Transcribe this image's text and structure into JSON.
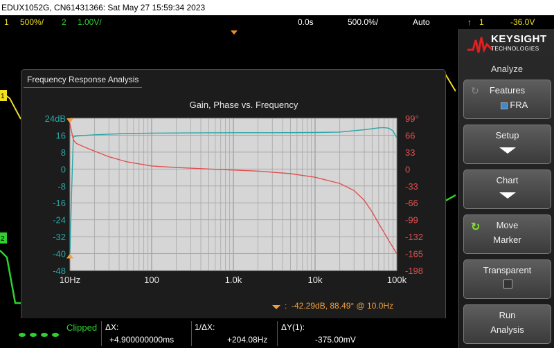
{
  "titlebar": {
    "text": "EDUX1052G, CN61431366: Sat May 27 15:59:34 2023"
  },
  "status": {
    "ch1_num": "1",
    "ch1_scale": "500%/",
    "ch2_num": "2",
    "ch2_scale": "1.00V/",
    "delay": "0.0s",
    "timebase": "500.0%/",
    "trigger_mode": "Auto",
    "trig_source": "1",
    "trig_level": "-36.0V"
  },
  "fra": {
    "window_title": "Frequency Response Analysis",
    "marker_readout": "-42.29dB, 88.49° @ 10.0Hz"
  },
  "chart_data": {
    "type": "line",
    "title": "Gain, Phase vs. Frequency",
    "xscale": "log",
    "x_range": [
      10,
      100000
    ],
    "x_tick_labels": [
      "10Hz",
      "100",
      "1.0k",
      "10k",
      "100k"
    ],
    "y_left_ticks": [
      "24dB",
      "16",
      "8",
      "0",
      "-8",
      "-16",
      "-24",
      "-32",
      "-40",
      "-48"
    ],
    "y_left_range": [
      -48,
      24
    ],
    "y_right_ticks": [
      "99°",
      "66",
      "33",
      "0",
      "-33",
      "-66",
      "-99",
      "-132",
      "-165",
      "-198"
    ],
    "y_right_range": [
      -198,
      99
    ],
    "grid": true,
    "series": [
      {
        "axis": "left",
        "color": "#2aa6a6",
        "x": [
          10,
          10.5,
          11,
          12,
          15,
          20,
          30,
          50,
          100,
          300,
          1000,
          3000,
          10000,
          20000,
          40000,
          60000,
          70000,
          80000,
          90000,
          100000
        ],
        "y": [
          -40,
          -10,
          15.2,
          15.6,
          15.9,
          16.2,
          16.5,
          16.8,
          17.0,
          17.1,
          17.2,
          17.2,
          17.3,
          17.5,
          18.6,
          19.5,
          19.6,
          19.3,
          18.0,
          14.8
        ]
      },
      {
        "axis": "right",
        "color": "#e05050",
        "x": [
          10,
          11,
          12,
          15,
          20,
          30,
          50,
          100,
          200,
          500,
          1000,
          2000,
          5000,
          10000,
          20000,
          30000,
          40000,
          50000,
          60000,
          70000,
          80000,
          90000,
          100000
        ],
        "y": [
          88.5,
          57,
          50,
          43,
          35,
          24,
          14,
          6,
          3,
          0,
          -2,
          -4,
          -9,
          -16,
          -28,
          -42,
          -61,
          -84,
          -106,
          -124,
          -140,
          -153,
          -165
        ]
      }
    ],
    "marker_freq": 10,
    "marker_gain": -42.29,
    "marker_phase": 88.49
  },
  "bottom": {
    "clipped": "Clipped",
    "dx_label": "ΔX:",
    "dx_value": "+4.900000000ms",
    "inv_dx_label": "1/ΔX:",
    "inv_dx_value": "+204.08Hz",
    "dy_label": "ΔY(1):",
    "dy_value": "-375.00mV"
  },
  "sidebar": {
    "brand_line1": "KEYSIGHT",
    "brand_line2": "TECHNOLOGIES",
    "menu_title": "Analyze",
    "features_label": "Features",
    "features_value": "FRA",
    "setup_label": "Setup",
    "chart_label": "Chart",
    "move_label": "Move",
    "move_label2": "Marker",
    "transparent_label": "Transparent",
    "run_label": "Run",
    "run_label2": "Analysis"
  },
  "colors": {
    "ch1": "#f0e020",
    "ch2": "#30d030",
    "gain": "#2aa6a6",
    "phase": "#e05050",
    "marker": "#f0a040"
  }
}
